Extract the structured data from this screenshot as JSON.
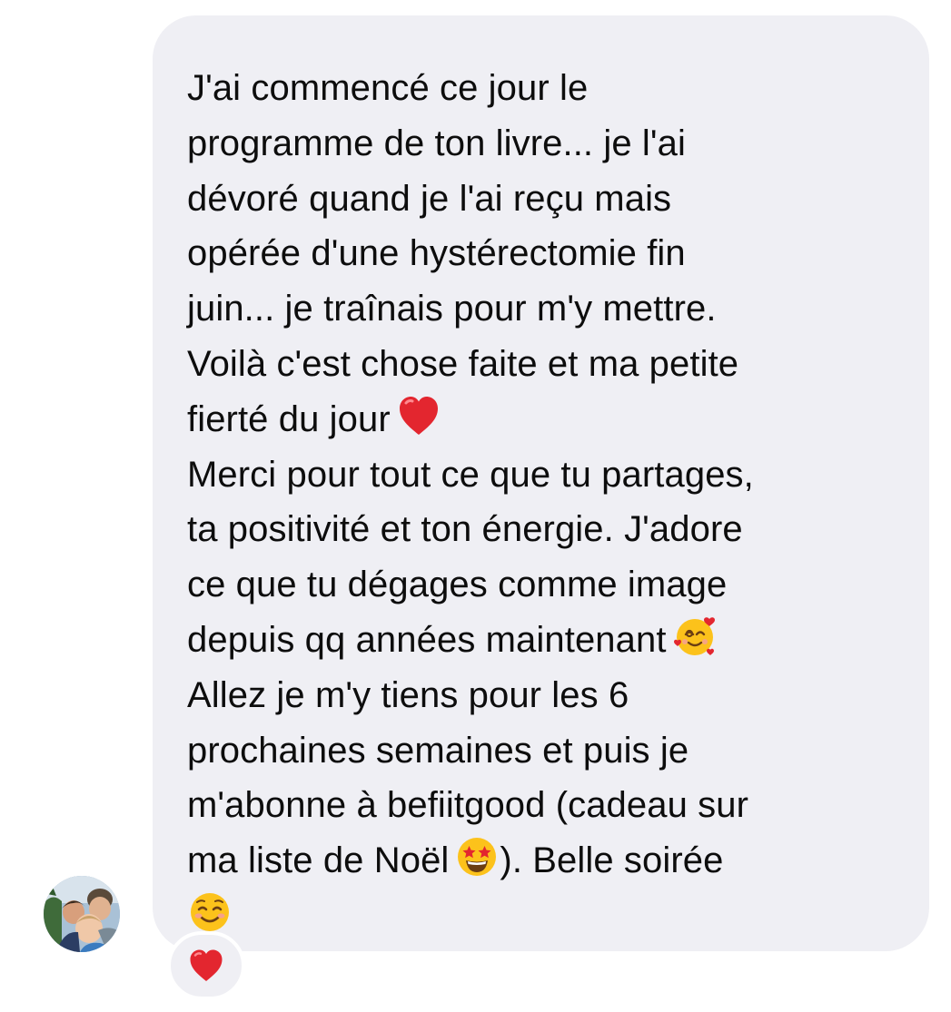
{
  "message": {
    "lines": [
      "J'ai commencé ce jour le",
      "programme de ton livre... je l'ai",
      "dévoré quand je l'ai reçu mais",
      "opérée d'une hystérectomie fin",
      "juin... je traînais pour m'y mettre.",
      "Voilà c'est chose faite et ma petite",
      "fierté du jour",
      "Merci pour tout ce que tu partages,",
      "ta positivité et ton énergie. J'adore",
      "ce que tu dégages comme image",
      "depuis qq années maintenant",
      "Allez je m'y tiens pour les 6",
      "prochaines semaines et puis je",
      "m'abonne à befiitgood (cadeau sur",
      "ma liste de Noël",
      "). Belle soirée"
    ],
    "emojis": {
      "heart": "red-heart-emoji",
      "smiling_hearts": "smiling-face-with-hearts-emoji",
      "star_struck": "star-struck-emoji",
      "smiling": "smiling-face-emoji"
    }
  },
  "reaction": {
    "icon": "red-heart-emoji"
  },
  "colors": {
    "bubble_background": "#efeff4",
    "text": "#0d0d0d",
    "heart": "#e3262f",
    "emoji_yellow": "#fcc21b"
  }
}
